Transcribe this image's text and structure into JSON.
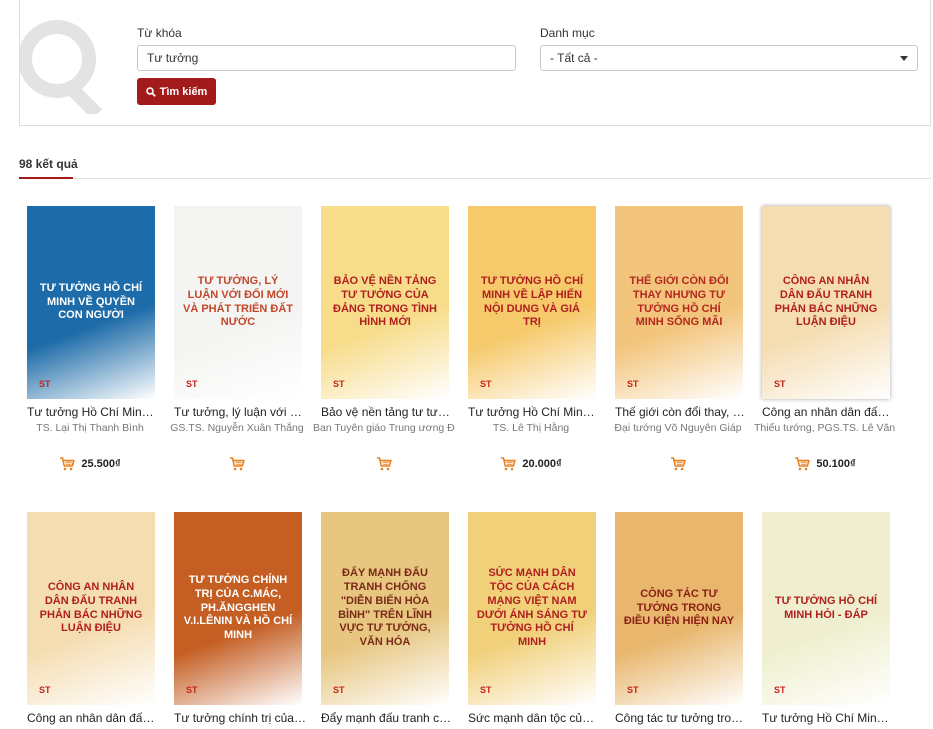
{
  "search": {
    "keyword_label": "Từ khóa",
    "keyword_value": "Tư tưởng",
    "category_label": "Danh mục",
    "category_value": "- Tất cả -",
    "button_label": "Tìm kiếm"
  },
  "results": {
    "count_label": "98 kết quả"
  },
  "books": [
    {
      "title": "Tư tưởng Hồ Chí Minh về quyền con người",
      "author": "TS. Lại Thị Thanh Bình",
      "price": "25.500₫",
      "cover_text": "Tư tưởng Hồ Chí Minh về quyền con người",
      "bg": "#1d6ba8",
      "fg": "#ffffff"
    },
    {
      "title": "Tư tưởng, lý luận với đổi mới và phát triển đất nước",
      "author": "GS.TS. Nguyễn Xuân Thắng",
      "price": "",
      "cover_text": "Tư tưởng, lý luận với đổi mới và phát triển đất nước",
      "bg": "#f4f4f2",
      "fg": "#c2472b"
    },
    {
      "title": "Bảo vệ nền tảng tư tưởng của Đảng trong tình hình mới",
      "author": "Ban Tuyên giáo Trung ương Đảng",
      "price": "",
      "cover_text": "Bảo vệ nền tảng tư tưởng của Đảng trong tình hình mới",
      "bg": "#f7dc8a",
      "fg": "#b01f1f"
    },
    {
      "title": "Tư tưởng Hồ Chí Minh về lập hiến - nội dung và giá trị",
      "author": "TS. Lê Thị Hằng",
      "price": "20.000₫",
      "cover_text": "Tư tưởng Hồ Chí Minh về lập hiến nội dung và giá trị",
      "bg": "#f6c96a",
      "fg": "#b01f1f"
    },
    {
      "title": "Thế giới còn đổi thay, nhưng tư tưởng Hồ Chí Minh sống mãi",
      "author": "Đại tướng Võ Nguyên Giáp",
      "price": "",
      "cover_text": "Thế giới còn đổi thay nhưng tư tưởng Hồ Chí Minh sống mãi",
      "bg": "#f3c57c",
      "fg": "#b3281f"
    },
    {
      "title": "Công an nhân dân đấu tranh phản bác những luận điệu",
      "author": "Thiếu tướng, PGS.TS. Lê Văn Cương",
      "price": "50.100₫",
      "cover_text": "Công an nhân dân đấu tranh phản bác những luận điệu",
      "bg": "#f5ddb2",
      "fg": "#b01f1f"
    },
    {
      "title": "Công an nhân dân đấu tranh phản bác những luận điệu",
      "author": "",
      "price": "",
      "cover_text": "Công an nhân dân đấu tranh phản bác những luận điệu",
      "bg": "#f5ddb2",
      "fg": "#b01f1f"
    },
    {
      "title": "Tư tưởng chính trị của C.Mác, Ph.Ăngghen",
      "author": "",
      "price": "",
      "cover_text": "Tư tưởng chính trị của C.Mác, Ph.Ăngghen V.I.Lênin và Hồ Chí Minh",
      "bg": "#c45e23",
      "fg": "#ffffff"
    },
    {
      "title": "Đẩy mạnh đấu tranh chống diễn biến hòa bình",
      "author": "",
      "price": "",
      "cover_text": "Đẩy mạnh đấu tranh chống \"diễn biến hòa bình\" trên lĩnh vực tư tưởng, văn hóa",
      "bg": "#e7c680",
      "fg": "#7a2a17"
    },
    {
      "title": "Sức mạnh dân tộc của cách mạng Việt Nam",
      "author": "",
      "price": "",
      "cover_text": "Sức mạnh dân tộc của cách mạng Việt Nam dưới ánh sáng tư tưởng Hồ Chí Minh",
      "bg": "#f1d07a",
      "fg": "#b01f1f"
    },
    {
      "title": "Công tác tư tưởng trong điều kiện hiện nay",
      "author": "",
      "price": "",
      "cover_text": "Công tác tư tưởng trong điều kiện hiện nay",
      "bg": "#e8b66c",
      "fg": "#8a1f15"
    },
    {
      "title": "Tư tưởng Hồ Chí Minh hỏi - đáp",
      "author": "",
      "price": "",
      "cover_text": "Tư tưởng Hồ Chí Minh hỏi - đáp",
      "bg": "#efefcf",
      "fg": "#b01f1f"
    }
  ]
}
